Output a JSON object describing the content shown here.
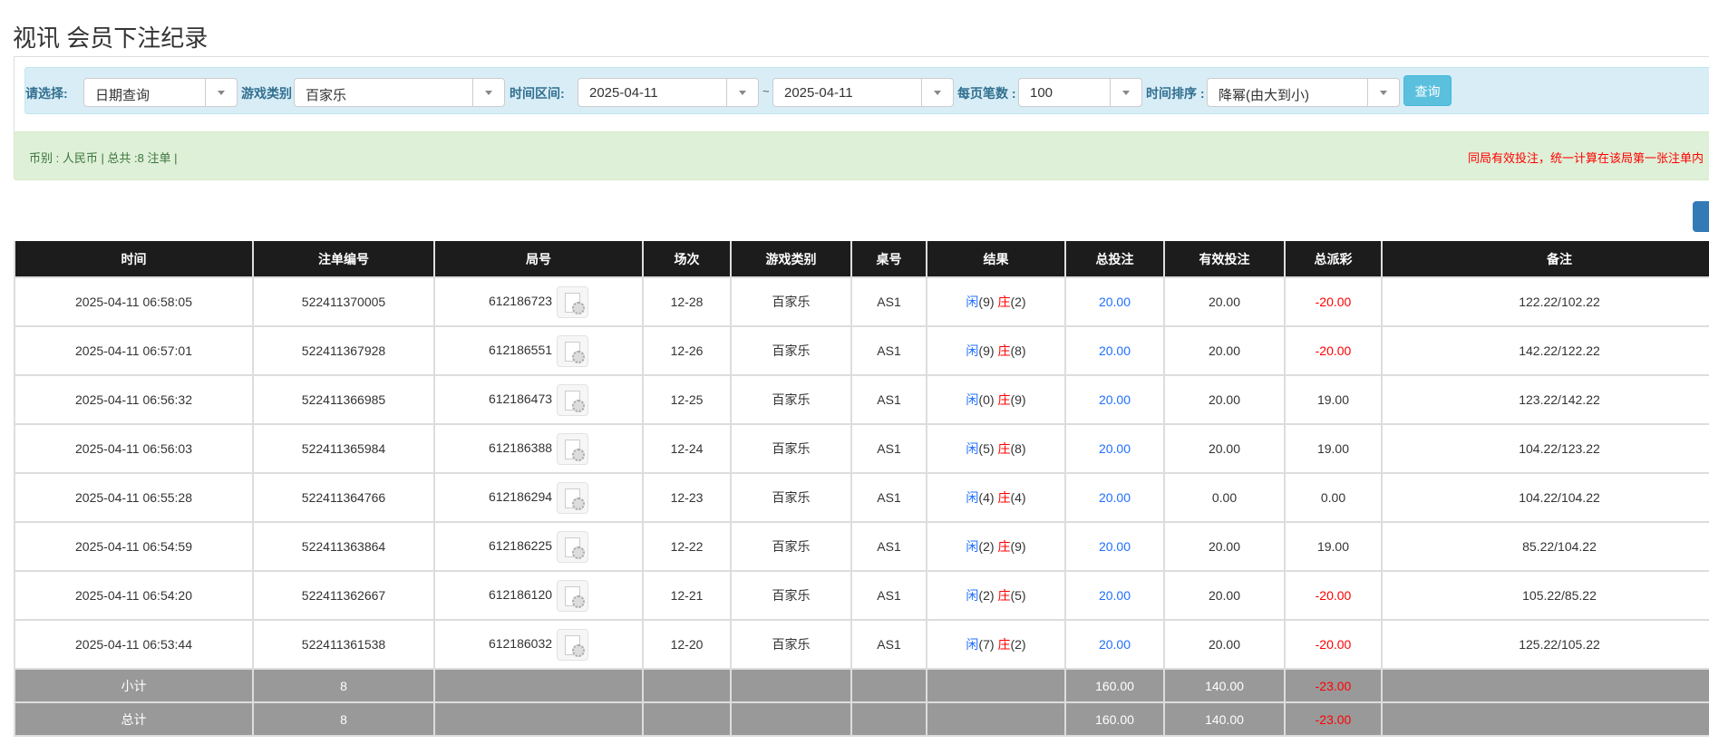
{
  "page": {
    "title": "视讯 会员下注纪录"
  },
  "filters": {
    "select_label": "请选择:",
    "select_value": "日期查询",
    "game_type_label": "游戏类别",
    "game_type_value": "百家乐",
    "time_range_label": "时间区间:",
    "date_from": "2025-04-11",
    "tilde": "~",
    "date_to": "2025-04-11",
    "per_page_label": "每页笔数 :",
    "per_page_value": "100",
    "sort_label": "时间排序 :",
    "sort_value": "降幂(由大到小)",
    "query_button": "查询"
  },
  "info": {
    "summary": "币别 : 人民币 | 总共 :8 注单 |",
    "notice": "同局有效投注，统一计算在该局第一张注单内"
  },
  "table": {
    "headers": [
      "时间",
      "注单编号",
      "局号",
      "场次",
      "游戏类别",
      "桌号",
      "结果",
      "总投注",
      "有效投注",
      "总派彩",
      "备注"
    ],
    "rows": [
      {
        "time": "2025-04-11 06:58:05",
        "bet_id": "522411370005",
        "round": "612186723",
        "session": "12-28",
        "game": "百家乐",
        "table": "AS1",
        "player": "闲",
        "player_pts": "(9)",
        "banker": "庄",
        "banker_pts": "(2)",
        "total": "20.00",
        "valid": "20.00",
        "payout": "-20.00",
        "payout_neg": true,
        "note": "122.22/102.22"
      },
      {
        "time": "2025-04-11 06:57:01",
        "bet_id": "522411367928",
        "round": "612186551",
        "session": "12-26",
        "game": "百家乐",
        "table": "AS1",
        "player": "闲",
        "player_pts": "(9)",
        "banker": "庄",
        "banker_pts": "(8)",
        "total": "20.00",
        "valid": "20.00",
        "payout": "-20.00",
        "payout_neg": true,
        "note": "142.22/122.22"
      },
      {
        "time": "2025-04-11 06:56:32",
        "bet_id": "522411366985",
        "round": "612186473",
        "session": "12-25",
        "game": "百家乐",
        "table": "AS1",
        "player": "闲",
        "player_pts": "(0)",
        "banker": "庄",
        "banker_pts": "(9)",
        "total": "20.00",
        "valid": "20.00",
        "payout": "19.00",
        "payout_neg": false,
        "note": "123.22/142.22"
      },
      {
        "time": "2025-04-11 06:56:03",
        "bet_id": "522411365984",
        "round": "612186388",
        "session": "12-24",
        "game": "百家乐",
        "table": "AS1",
        "player": "闲",
        "player_pts": "(5)",
        "banker": "庄",
        "banker_pts": "(8)",
        "total": "20.00",
        "valid": "20.00",
        "payout": "19.00",
        "payout_neg": false,
        "note": "104.22/123.22"
      },
      {
        "time": "2025-04-11 06:55:28",
        "bet_id": "522411364766",
        "round": "612186294",
        "session": "12-23",
        "game": "百家乐",
        "table": "AS1",
        "player": "闲",
        "player_pts": "(4)",
        "banker": "庄",
        "banker_pts": "(4)",
        "total": "20.00",
        "valid": "0.00",
        "payout": "0.00",
        "payout_neg": false,
        "note": "104.22/104.22"
      },
      {
        "time": "2025-04-11 06:54:59",
        "bet_id": "522411363864",
        "round": "612186225",
        "session": "12-22",
        "game": "百家乐",
        "table": "AS1",
        "player": "闲",
        "player_pts": "(2)",
        "banker": "庄",
        "banker_pts": "(9)",
        "total": "20.00",
        "valid": "20.00",
        "payout": "19.00",
        "payout_neg": false,
        "note": "85.22/104.22"
      },
      {
        "time": "2025-04-11 06:54:20",
        "bet_id": "522411362667",
        "round": "612186120",
        "session": "12-21",
        "game": "百家乐",
        "table": "AS1",
        "player": "闲",
        "player_pts": "(2)",
        "banker": "庄",
        "banker_pts": "(5)",
        "total": "20.00",
        "valid": "20.00",
        "payout": "-20.00",
        "payout_neg": true,
        "note": "105.22/85.22"
      },
      {
        "time": "2025-04-11 06:53:44",
        "bet_id": "522411361538",
        "round": "612186032",
        "session": "12-20",
        "game": "百家乐",
        "table": "AS1",
        "player": "闲",
        "player_pts": "(7)",
        "banker": "庄",
        "banker_pts": "(2)",
        "total": "20.00",
        "valid": "20.00",
        "payout": "-20.00",
        "payout_neg": true,
        "note": "125.22/105.22"
      }
    ],
    "subtotal": {
      "label": "小计",
      "count": "8",
      "total": "160.00",
      "valid": "140.00",
      "payout": "-23.00"
    },
    "grandtotal": {
      "label": "总计",
      "count": "8",
      "total": "160.00",
      "valid": "140.00",
      "payout": "-23.00"
    }
  },
  "colors": {
    "header_bg": "#1c1c1c",
    "player": "#1f6fff",
    "banker": "#ff0000",
    "sum_bg": "#999999",
    "filter_bg": "#d9edf7",
    "info_bg": "#dff0d8"
  }
}
